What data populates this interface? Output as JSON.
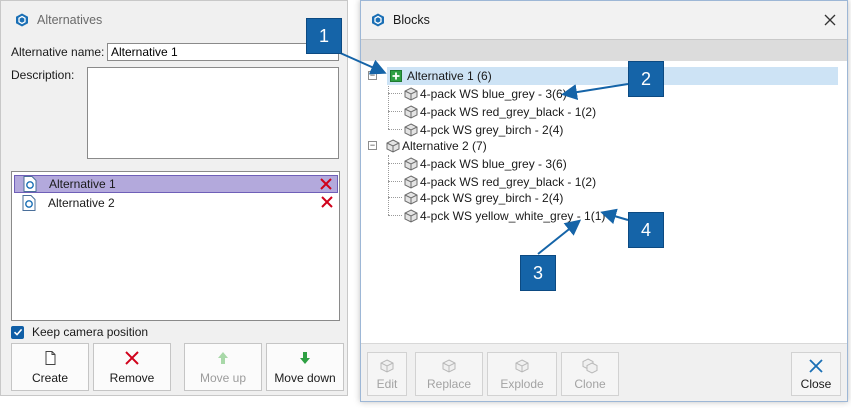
{
  "alternatives_window": {
    "title": "Alternatives",
    "name_label": "Alternative name:",
    "name_value": "Alternative 1",
    "description_label": "Description:",
    "description_value": "",
    "list": [
      {
        "label": "Alternative 1",
        "selected": true
      },
      {
        "label": "Alternative 2",
        "selected": false
      }
    ],
    "keep_camera_label": "Keep camera position",
    "keep_camera_checked": true,
    "buttons": {
      "create": "Create",
      "remove": "Remove",
      "move_up": "Move up",
      "move_down": "Move down"
    }
  },
  "blocks_window": {
    "title": "Blocks",
    "tree": [
      {
        "label": "Alternative 1 (6)",
        "selected": true,
        "children": [
          "4-pack WS blue_grey - 3(6)",
          "4-pack WS red_grey_black - 1(2)",
          "4-pck WS grey_birch - 2(4)"
        ]
      },
      {
        "label": "Alternative 2 (7)",
        "selected": false,
        "children": [
          "4-pack WS blue_grey - 3(6)",
          "4-pack WS red_grey_black - 1(2)",
          "4-pck WS grey_birch - 2(4)",
          "4-pck WS yellow_white_grey - 1(1)"
        ]
      }
    ],
    "buttons": {
      "edit": "Edit",
      "replace": "Replace",
      "explode": "Explode",
      "clone": "Clone",
      "close": "Close"
    }
  },
  "callouts": [
    "1",
    "2",
    "3",
    "4"
  ],
  "colors": {
    "accent": "#1564a8",
    "selection_list": "#b3a9dc",
    "selection_tree": "#cde3f5",
    "delete_red": "#d0021b",
    "move_green": "#2ea043"
  },
  "icons": {
    "app": "hexagon-logo-icon",
    "alternative": "document-icon",
    "delete": "red-x-icon",
    "block": "cube-icon",
    "alternative_active": "green-plus-icon"
  }
}
